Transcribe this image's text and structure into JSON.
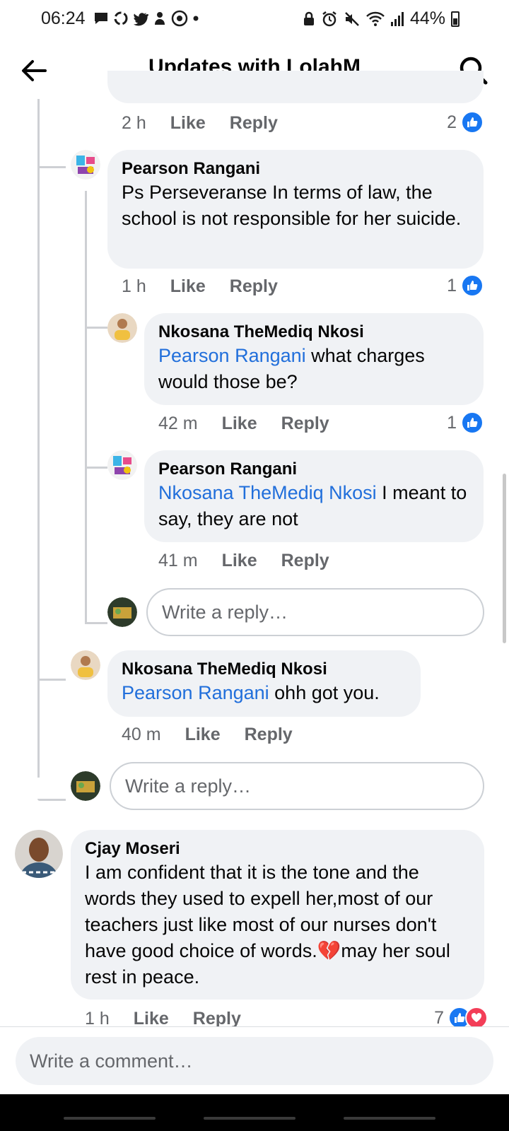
{
  "status_bar": {
    "time": "06:24",
    "battery": "44%",
    "left_icons": [
      "message-icon",
      "recycle-icon",
      "twitter-icon",
      "person-icon",
      "whatsapp-icon",
      "dot-icon"
    ],
    "right_icons": [
      "lock-icon",
      "alarm-icon",
      "mute-icon",
      "wifi-icon",
      "signal-icon",
      "battery-icon"
    ]
  },
  "header": {
    "title": "Updates with LolahM"
  },
  "comments": [
    {
      "time": "2 h",
      "like_label": "Like",
      "reply_label": "Reply",
      "reaction_count": "2"
    },
    {
      "author": "Pearson Rangani",
      "text": "Ps Perseveranse In terms of law, the school is not responsible for her suicide.",
      "time": "1 h",
      "like_label": "Like",
      "reply_label": "Reply",
      "reaction_count": "1"
    },
    {
      "author": "Nkosana TheMediq Nkosi",
      "mention": "Pearson Rangani",
      "text": " what charges would those be?",
      "time": "42 m",
      "like_label": "Like",
      "reply_label": "Reply",
      "reaction_count": "1"
    },
    {
      "author": "Pearson Rangani",
      "mention": "Nkosana TheMediq Nkosi",
      "text": " I meant to say, they are not",
      "time": "41 m",
      "like_label": "Like",
      "reply_label": "Reply"
    },
    {
      "author": "Nkosana TheMediq Nkosi",
      "mention": "Pearson Rangani",
      "text": " ohh got you.",
      "time": "40 m",
      "like_label": "Like",
      "reply_label": "Reply"
    },
    {
      "author": "Cjay Moseri",
      "text": "I am confident that it is the tone and the words they used to expell her,most of our teachers just like most of our nurses don't have good choice of words.",
      "emoji": "💔",
      "text_after": "may her soul rest in peace.",
      "time": "1 h",
      "like_label": "Like",
      "reply_label": "Reply",
      "reaction_count": "7"
    }
  ],
  "reply_placeholder": "Write a reply…",
  "composer": {
    "placeholder": "Write a comment…"
  },
  "colors": {
    "accent": "#1877f2",
    "mention": "#216fdb",
    "bubble": "#f0f2f5",
    "meta": "#65676b",
    "heart": "#f33e58"
  }
}
